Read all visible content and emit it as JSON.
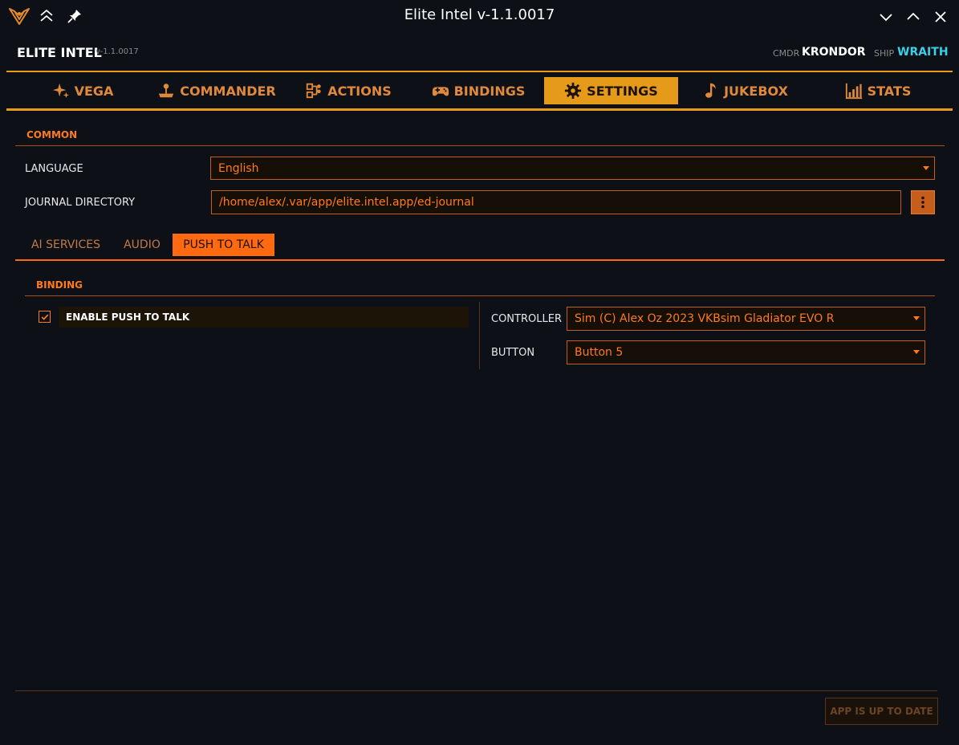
{
  "window": {
    "title": "Elite Intel v-1.1.0017"
  },
  "header": {
    "brand": "ELITE INTEL",
    "version": "v-1.1.0017",
    "cmdr_label": "CMDR",
    "cmdr_name": "KRONDOR",
    "ship_label": "SHIP",
    "ship_name": "WRAITH"
  },
  "nav": {
    "tabs": [
      {
        "label": "VEGA",
        "icon": "sparkle-icon"
      },
      {
        "label": "COMMANDER",
        "icon": "joystick-icon"
      },
      {
        "label": "ACTIONS",
        "icon": "actions-icon"
      },
      {
        "label": "BINDINGS",
        "icon": "gamepad-icon"
      },
      {
        "label": "SETTINGS",
        "icon": "gear-icon",
        "active": true
      },
      {
        "label": "JUKEBOX",
        "icon": "music-note-icon"
      },
      {
        "label": "STATS",
        "icon": "bar-chart-icon"
      }
    ]
  },
  "common": {
    "title": "COMMON",
    "language_label": "LANGUAGE",
    "language_value": "English",
    "journal_label": "JOURNAL DIRECTORY",
    "journal_value": "/home/alex/.var/app/elite.intel.app/ed-journal"
  },
  "subtabs": [
    {
      "label": "AI SERVICES"
    },
    {
      "label": "AUDIO"
    },
    {
      "label": "PUSH TO TALK",
      "active": true
    }
  ],
  "binding": {
    "title": "BINDING",
    "enable_ptt_label": "ENABLE PUSH TO TALK",
    "enable_ptt_checked": true,
    "controller_label": "CONTROLLER",
    "controller_value": "Sim (C) Alex Oz 2023 VKBsim Gladiator EVO R",
    "button_label": "BUTTON",
    "button_value": "Button 5"
  },
  "footer": {
    "update_status": "APP IS UP TO DATE"
  },
  "colors": {
    "accent": "#e69a1a",
    "orange": "#ff7a1a",
    "background": "#0d1117",
    "ship": "#3ad0e8"
  }
}
